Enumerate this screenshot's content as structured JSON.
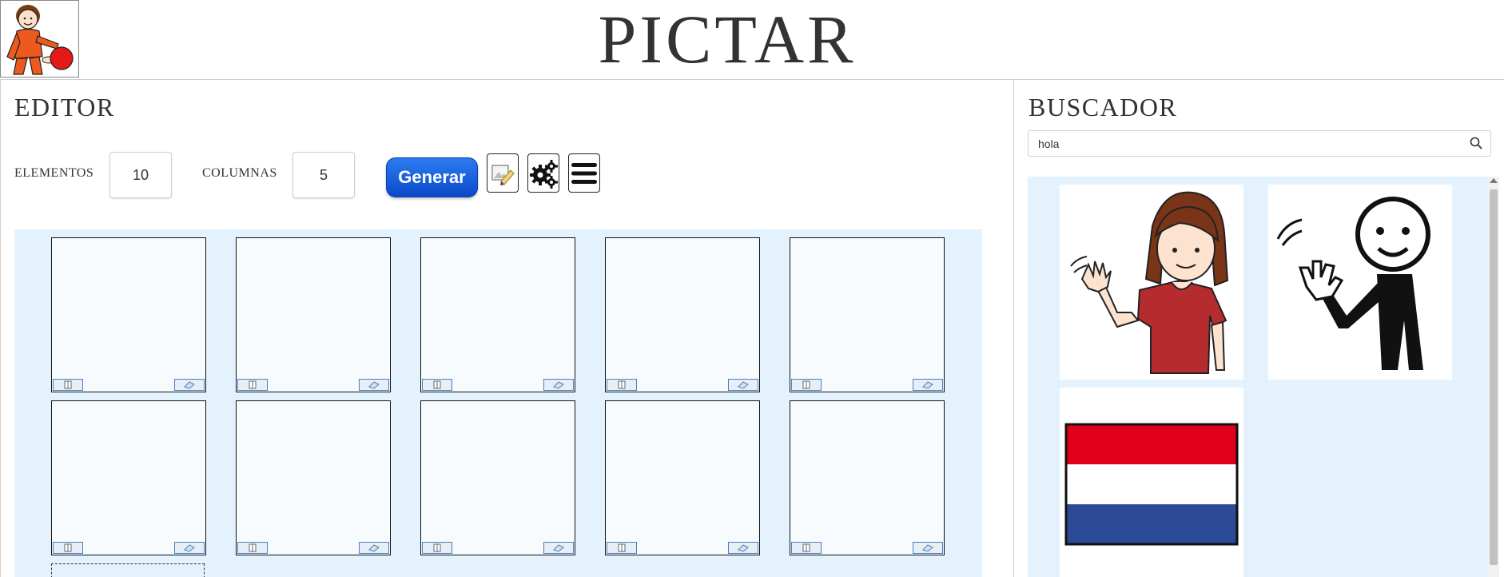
{
  "app": {
    "title": "PICTAR"
  },
  "editor": {
    "title": "EDITOR",
    "elements_label": "ELEMENTOS",
    "elements_value": "10",
    "columns_label": "COLUMNAS",
    "columns_value": "5",
    "generate_label": "Generar",
    "tools": [
      "edit-image-icon",
      "settings-gears-icon",
      "menu-icon"
    ]
  },
  "search": {
    "title": "BUSCADOR",
    "query": "hola",
    "results": [
      "girl-waving-pictogram",
      "stick-figure-waving-pictogram",
      "netherlands-flag-pictogram"
    ]
  },
  "colors": {
    "accent": "#0a49c9",
    "grid_bg": "#e3f2fd"
  }
}
